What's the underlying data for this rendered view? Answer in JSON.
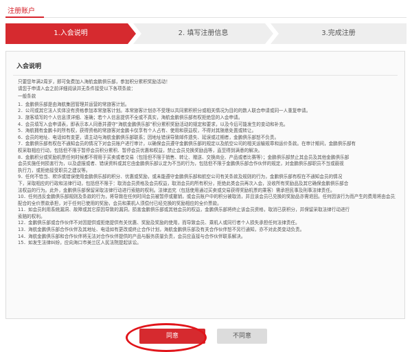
{
  "header": {
    "title": "注册账户"
  },
  "steps": [
    {
      "label": "1.入会说明"
    },
    {
      "label": "2. 填写注册信息"
    },
    {
      "label": "3.完成注册"
    }
  ],
  "panel": {
    "title": "入会说明",
    "lines": [
      "只要您年满2周岁，即可免费加入海航金鹏俱乐部，参加积分累积奖励活动！",
      "请您于申请入会之前详细阅读并无条件接受以下各项条款：",
      "一般条款",
      "1．金鹏俱乐部是由海航集团管理并运营的常旅客计划。",
      "2．公司或其它法人实体没有资格参加本常旅客计划。本常旅客计划亦不受理以共同累积积分或相关情况为目的的数人联合申请或同一人重复申请。",
      "3．旅客填写的个人信息须详细、准确；若个人信息提供不全或不真实，海航金鹏俱乐部有权拒绝您的入会申请。",
      "4．会员填写入会申请表，即表示本人同意并遵守“海航金鹏俱乐部”积分累积奖励活动的规定和要求，以及今后可能发生的变动和补充。",
      "5．海航拥有金鹏卡的所有权，获得资格的常旅客对金鹏卡仅享有个人占有、使用和获益权，不得对其随意处置或转让。",
      "6．会员的地址、电话如有变更，请主动与海航金鹏俱乐部联系；因地址错误导致邮件遗失、延误或过期者，金鹏俱乐部恕不负责。",
      "7．金鹏俱乐部有权在不通知会员的情况下对会员账户进行审计，以确保会员遵守金鹏俱乐部的规定以及航空公司的相关运输规章和运价条款。在审计期间，金鹏俱乐部有",
      "权采取相应行动，包括但不限于暂停会员积分累积、暂停会员优惠和权益，禁止会员兑换奖励品等，直至得到满意的解决。",
      "8．金鹏积分或奖励机票任何时候都不得用于买卖或者交易（包括但不限于销售、转让、赠送、交换商业、产品或者比赛等）；金鹏俱乐部禁止其会员及其他金鹏俱乐部",
      "会员实施任何损害行为，以及虚报或者、错误资料或其它由金鹏俱乐部认定为不当的行为，包括但不限于金鹏俱乐部合作伙伴的规定，对金鹏俱乐部职员不当或藐视",
      "执行力，或拒绝接受职员之建议等。",
      "9．任何不恰当、欺诈或错误使用金鹏俱乐部的积分、优惠或奖励，或未能遵守金鹏俱乐部和航空公司有关条款及规则的行为，金鹏俱乐部有权在不通知会员的情况",
      "下，采取相应的行政和法律行动，包括但不限于：取消会员资格及会员权益，取消会员的所有积分，拒绝此类会员再次入会，没收所有奖励品及其它确保金鹏俱乐部合",
      "法权益的行为。此外，金鹏俱乐部保留采取法律行动进行索赔的权利。法律追究（包括使用通过买卖或交易获得奖励机票的乘客）需承担民事及刑事法律责任。",
      "10．任何违反金鹏俱乐部规则及条款的行为，将导致在任何时间会员被暂停或撤销，或会员账户中的积分被取消，并且该会员已兑换的奖励品亦需退回。任何因该行为而产生的费用将由会员支付。",
      "配合的全价票款承担，对于任何已使用的奖励，会员和乘机人须偿付已经兑换的奖励相应的全价票款。",
      "11．如会员利用系统漏洞、故障或其它原因导致的漏洞，损害金鹏俱乐部或其他会员的权益，金鹏俱乐部将终止该会员资格，取消已获积分，并保留采取法律行动进行",
      "索赔的权利。",
      "12．金鹏俱乐部或合作伙伴不对因提供或拒绝提供有关优惠、奖励及奖励的使用，而导致会员、乘机人或同行者个人损失承担任何法律责任。",
      "13．海航金鹏俱乐部合作伙伴及其地址、电话如有更改或终止合作计划，海航金鹏俱乐部及有关合作伙伴恕不另行通知，亦不对此类变动负责。",
      "14．海航金鹏俱乐部和合作伙伴将无法对合作伙伴提供的产品与服务质量负责，会员应直接与合作伙伴联系解决。",
      "15．如发生法律纠纷，应向海口市美兰区人民法院提起诉讼。"
    ]
  },
  "buttons": {
    "agree": "同意",
    "disagree": "不同意"
  },
  "colors": {
    "accent": "#d62a2f",
    "inactive": "#eeeeee"
  }
}
